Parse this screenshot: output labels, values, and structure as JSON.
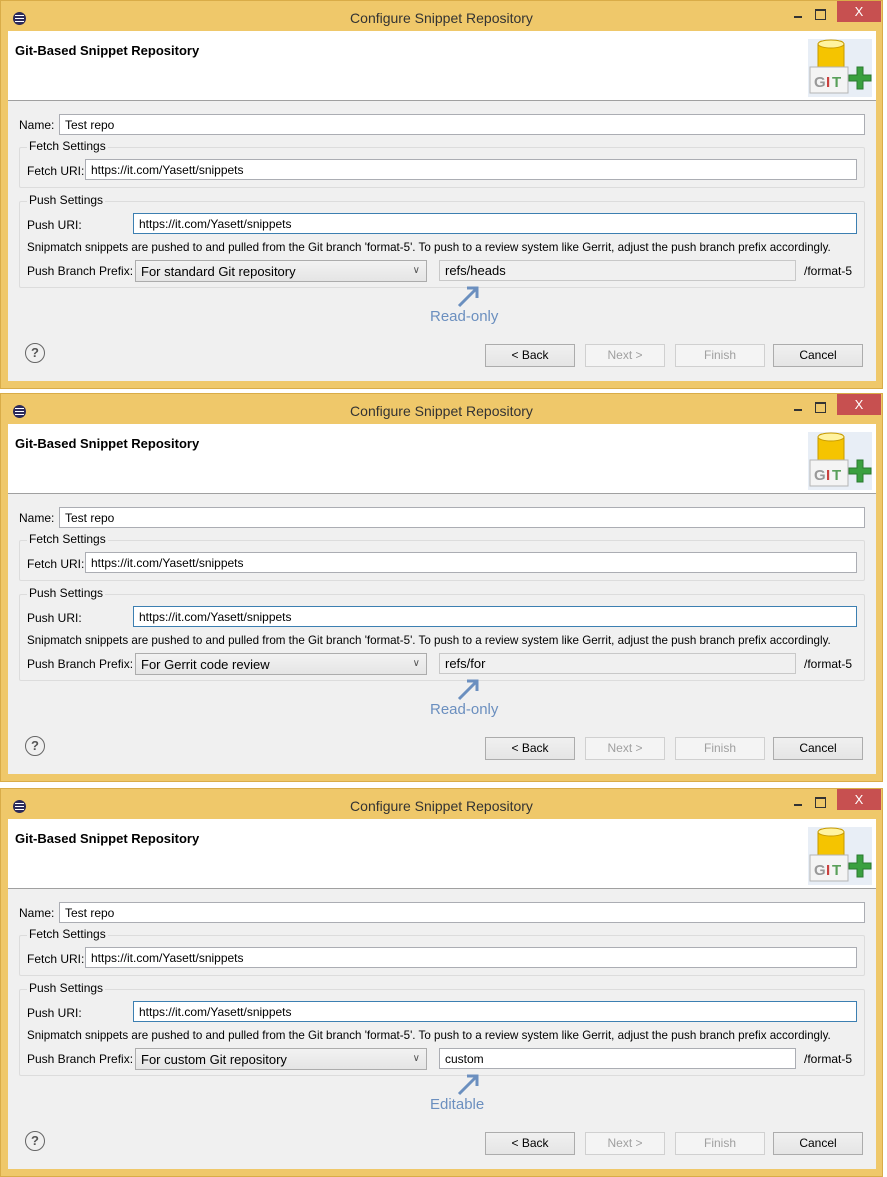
{
  "dialogs": [
    {
      "window_title": "Configure Snippet Repository",
      "close_label": "X",
      "header_title": "Git-Based Snippet Repository",
      "name_label": "Name:",
      "name_value": "Test repo",
      "fetch_group": "Fetch Settings",
      "fetch_uri_label": "Fetch URI:",
      "fetch_uri_value": "https://it.com/Yasett/snippets",
      "push_group": "Push Settings",
      "push_uri_label": "Push URI:",
      "push_uri_value": "https://it.com/Yasett/snippets",
      "description": "Snipmatch snippets are pushed to and pulled from the Git branch 'format-5'. To push to a review system like Gerrit, adjust the push branch prefix accordingly.",
      "prefix_label": "Push Branch Prefix:",
      "prefix_select": "For standard Git repository",
      "prefix_value": "refs/heads",
      "prefix_editable": false,
      "suffix": "/format-5",
      "annotation": "Read-only",
      "help": "?",
      "buttons": {
        "back": "< Back",
        "next": "Next >",
        "finish": "Finish",
        "cancel": "Cancel"
      }
    },
    {
      "window_title": "Configure Snippet Repository",
      "close_label": "X",
      "header_title": "Git-Based Snippet Repository",
      "name_label": "Name:",
      "name_value": "Test repo",
      "fetch_group": "Fetch Settings",
      "fetch_uri_label": "Fetch URI:",
      "fetch_uri_value": "https://it.com/Yasett/snippets",
      "push_group": "Push Settings",
      "push_uri_label": "Push URI:",
      "push_uri_value": "https://it.com/Yasett/snippets",
      "description": "Snipmatch snippets are pushed to and pulled from the Git branch 'format-5'. To push to a review system like Gerrit, adjust the push branch prefix accordingly.",
      "prefix_label": "Push Branch Prefix:",
      "prefix_select": "For Gerrit code review",
      "prefix_value": "refs/for",
      "prefix_editable": false,
      "suffix": "/format-5",
      "annotation": "Read-only",
      "help": "?",
      "buttons": {
        "back": "< Back",
        "next": "Next >",
        "finish": "Finish",
        "cancel": "Cancel"
      }
    },
    {
      "window_title": "Configure Snippet Repository",
      "close_label": "X",
      "header_title": "Git-Based Snippet Repository",
      "name_label": "Name:",
      "name_value": "Test repo",
      "fetch_group": "Fetch Settings",
      "fetch_uri_label": "Fetch URI:",
      "fetch_uri_value": "https://it.com/Yasett/snippets",
      "push_group": "Push Settings",
      "push_uri_label": "Push URI:",
      "push_uri_value": "https://it.com/Yasett/snippets",
      "description": "Snipmatch snippets are pushed to and pulled from the Git branch 'format-5'. To push to a review system like Gerrit, adjust the push branch prefix accordingly.",
      "prefix_label": "Push Branch Prefix:",
      "prefix_select": "For custom Git repository",
      "prefix_value": "custom",
      "prefix_editable": true,
      "suffix": "/format-5",
      "annotation": "Editable",
      "help": "?",
      "buttons": {
        "back": "< Back",
        "next": "Next >",
        "finish": "Finish",
        "cancel": "Cancel"
      }
    }
  ]
}
